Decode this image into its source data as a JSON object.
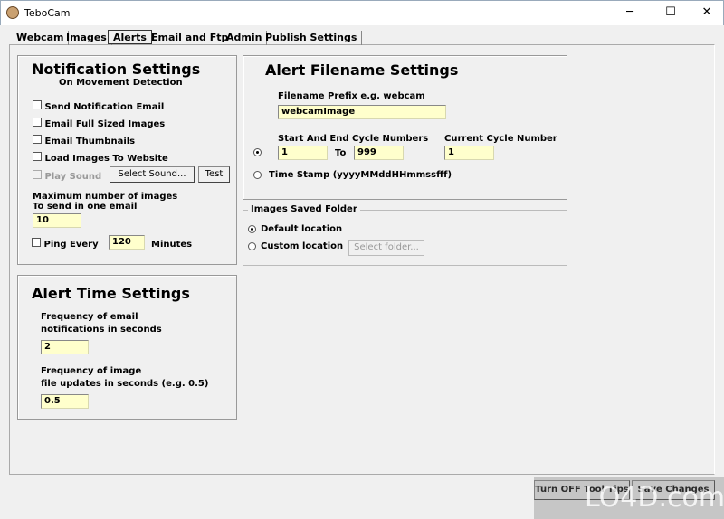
{
  "window": {
    "title": "TeboCam",
    "minimize": "─",
    "maximize": "☐",
    "close": "✕"
  },
  "tabs": [
    "Webcam",
    "Images",
    "Alerts",
    "Email and Ftp",
    "Admin",
    "Publish Settings"
  ],
  "notification": {
    "title": "Notification Settings",
    "subtitle": "On Movement Detection",
    "send_email": "Send Notification Email",
    "full_images": "Email Full Sized Images",
    "thumbnails": "Email Thumbnails",
    "load_website": "Load Images To Website",
    "play_sound": "Play Sound",
    "select_sound": "Select Sound...",
    "test": "Test",
    "max_label1": "Maximum number of images",
    "max_label2": "To send in one email",
    "max_value": "10",
    "ping_label": "Ping Every",
    "ping_value": "120",
    "minutes": "Minutes"
  },
  "filename": {
    "title": "Alert Filename Settings",
    "prefix_label": "Filename Prefix e.g. webcam",
    "prefix_value": "webcamImage",
    "cycle_label": "Start And End Cycle Numbers",
    "start": "1",
    "to": "To",
    "end": "999",
    "current_label": "Current Cycle Number",
    "current": "1",
    "timestamp": "Time Stamp (yyyyMMddHHmmssfff)"
  },
  "folder": {
    "title": "Images Saved Folder",
    "default": "Default location",
    "custom": "Custom location",
    "select": "Select folder..."
  },
  "alert_time": {
    "title": "Alert Time Settings",
    "email_freq1": "Frequency of email",
    "email_freq2": "notifications in seconds",
    "email_value": "2",
    "image_freq1": "Frequency of image",
    "image_freq2": "file updates in seconds (e.g. 0.5)",
    "image_value": "0.5"
  },
  "footer": {
    "tooltips": "Turn OFF Tool Tips",
    "save": "Save Changes"
  },
  "watermark": "LO4D.com"
}
